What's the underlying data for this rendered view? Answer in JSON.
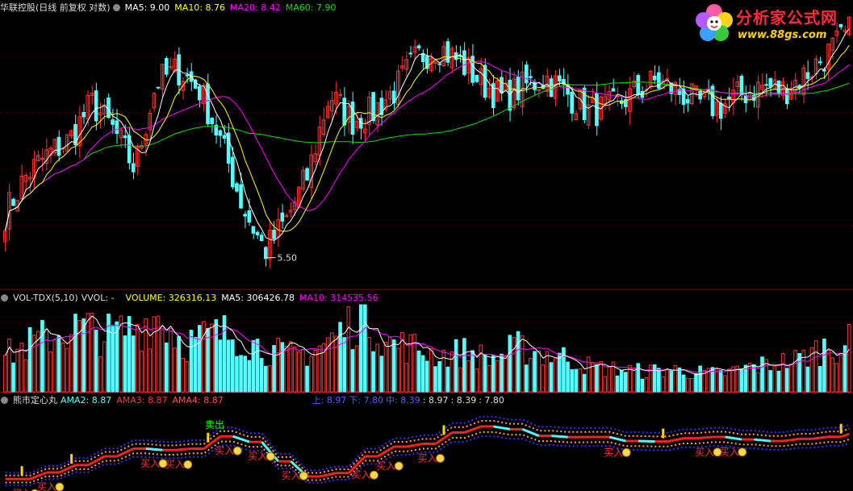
{
  "main_header": {
    "title": "华联控股(日线 前复权 对数)",
    "ma5": "MA5: 9.00",
    "ma10": "MA10: 8.76",
    "ma20": "MA20: 8.42",
    "ma60": "MA60: 7.90"
  },
  "vol_header": {
    "name": "VOL-TDX(5,10)",
    "vvol": "VVOL: -",
    "volume": "VOLUME: 326316.13",
    "ma5": "MA5: 306426.78",
    "ma10": "MA10: 314535.56"
  },
  "ind_header": {
    "name": "熊市定心丸",
    "ama2": "AMA2: 8.87",
    "ama3": "AMA3: 8.87",
    "ama4": "AMA4: 8.87",
    "up": "上: 8.97",
    "down": "下: 7.80",
    "mid": "中: 8.39",
    "v1": ": 8.97",
    "v2": ": 8.39",
    "v3": ": 7.80"
  },
  "logo": {
    "title": "分析家公式网",
    "url": "www.88gs.com"
  },
  "colors": {
    "up": "#ff3232",
    "down": "#54ffff",
    "ma5": "#ffffff",
    "ma10": "#ffff00",
    "ma20": "#ff00ff",
    "ma60": "#00e000",
    "buy_text": "#ff3030",
    "sell_text": "#00ff00",
    "grid": "#7a0000"
  },
  "chart_data": {
    "type": "candlestick",
    "low_label": "5.50",
    "low_value": 5.5,
    "last_close": 9.0,
    "ma_values": {
      "MA5": 9.0,
      "MA10": 8.76,
      "MA20": 8.42,
      "MA60": 7.9
    },
    "price_path": [
      6.2,
      6.9,
      7.3,
      7.6,
      8.4,
      7.8,
      7.0,
      8.9,
      9.2,
      8.7,
      7.5,
      6.3,
      5.6,
      6.1,
      6.9,
      8.6,
      8.0,
      8.2,
      8.7,
      9.5,
      9.8,
      9.4,
      8.9,
      8.5,
      8.8,
      9.0,
      8.6,
      8.2,
      8.3,
      8.6,
      8.9,
      8.7,
      8.4,
      8.3,
      8.6,
      8.8,
      8.7,
      9.1,
      9.6,
      10.2
    ],
    "volume_path": [
      0.45,
      0.6,
      0.72,
      0.8,
      0.7,
      0.78,
      0.95,
      0.6,
      0.7,
      0.72,
      0.55,
      0.45,
      0.5,
      0.7,
      0.98,
      0.6,
      0.55,
      0.45,
      0.5,
      0.4,
      0.55,
      0.48,
      0.42,
      0.3,
      0.28,
      0.25,
      0.28,
      0.24,
      0.22,
      0.3,
      0.35,
      0.4,
      0.55,
      0.6
    ],
    "signals": {
      "buy": "买入",
      "sell": "卖出",
      "buy_points": [
        0.02,
        0.05,
        0.17,
        0.2,
        0.26,
        0.3,
        0.34,
        0.42,
        0.45,
        0.5,
        0.72,
        0.83,
        0.86
      ],
      "sell_points": [
        0.25
      ]
    }
  }
}
